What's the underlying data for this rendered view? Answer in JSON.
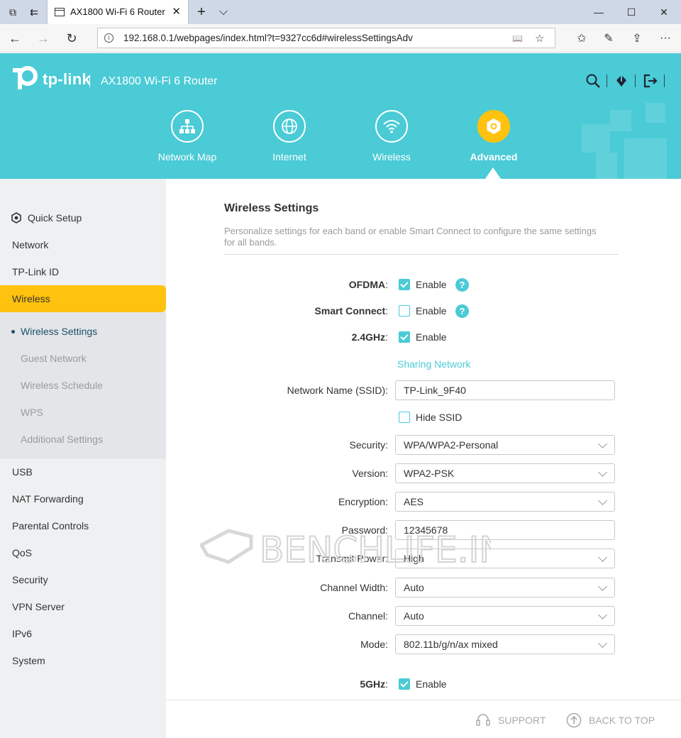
{
  "browser": {
    "tab_title": "AX1800 Wi-Fi 6 Router",
    "url": "192.168.0.1/webpages/index.html?t=9327cc6d#wirelessSettingsAdv",
    "new_tab_glyph": "+",
    "tab_list_glyph": "⌵",
    "minimize_glyph": "—",
    "maximize_glyph": "☐",
    "close_glyph": "✕",
    "tab_close_glyph": "✕",
    "back_glyph": "←",
    "forward_glyph": "→",
    "refresh_glyph": "↻",
    "info_glyph": "i",
    "reading_glyph": "📖",
    "favorite_glyph": "☆",
    "favorites_glyph": "✩",
    "pen_glyph": "✎",
    "share_glyph": "⇪",
    "more_glyph": "···",
    "tab_icon_1": "⧉",
    "tab_icon_2": "⇇"
  },
  "header": {
    "brand": "tp-link",
    "model": "AX1800 Wi-Fi 6 Router",
    "accent_color": "#4acbd6",
    "active_color": "#ffc20e",
    "icons": [
      "search-icon",
      "download-icon",
      "logout-icon"
    ]
  },
  "main_nav": [
    {
      "label": "Network Map",
      "icon": "network-map-icon"
    },
    {
      "label": "Internet",
      "icon": "globe-icon"
    },
    {
      "label": "Wireless",
      "icon": "wifi-icon"
    },
    {
      "label": "Advanced",
      "icon": "gear-icon"
    }
  ],
  "sidebar": {
    "items": [
      {
        "label": "Quick Setup"
      },
      {
        "label": "Network"
      },
      {
        "label": "TP-Link ID"
      },
      {
        "label": "Wireless"
      },
      {
        "label": "USB"
      },
      {
        "label": "NAT Forwarding"
      },
      {
        "label": "Parental Controls"
      },
      {
        "label": "QoS"
      },
      {
        "label": "Security"
      },
      {
        "label": "VPN Server"
      },
      {
        "label": "IPv6"
      },
      {
        "label": "System"
      }
    ],
    "subitems": [
      {
        "label": "Wireless Settings"
      },
      {
        "label": "Guest Network"
      },
      {
        "label": "Wireless Schedule"
      },
      {
        "label": "WPS"
      },
      {
        "label": "Additional Settings"
      }
    ]
  },
  "content": {
    "title": "Wireless Settings",
    "description": "Personalize settings for each band or enable Smart Connect to configure the same settings for all bands.",
    "ofdma_label": "OFDMA",
    "smart_connect_label": "Smart Connect",
    "band24_label": "2.4GHz",
    "band5_label": "5GHz",
    "enable_label": "Enable",
    "help_glyph": "?",
    "colon": ":",
    "sharing_network": "Sharing Network",
    "ssid_label": "Network Name (SSID):",
    "ssid_value": "TP-Link_9F40",
    "hide_ssid_label": "Hide SSID",
    "security_label": "Security:",
    "security_value": "WPA/WPA2-Personal",
    "version_label": "Version:",
    "version_value": "WPA2-PSK",
    "encryption_label": "Encryption:",
    "encryption_value": "AES",
    "password_label": "Password:",
    "password_value": "12345678",
    "tx_power_label": "Transmit Power:",
    "tx_power_value": "High",
    "channel_width_label": "Channel Width:",
    "channel_width_value": "Auto",
    "channel_label": "Channel:",
    "channel_value": "Auto",
    "mode_label": "Mode:",
    "mode_value": "802.11b/g/n/ax mixed",
    "checks": {
      "ofdma": true,
      "smart_connect": false,
      "band24": true,
      "hide_ssid": false,
      "band5": true
    }
  },
  "footer": {
    "support": "SUPPORT",
    "back_to_top": "BACK TO TOP"
  },
  "watermark": {
    "text": "BENCHLIFE.INFO"
  }
}
